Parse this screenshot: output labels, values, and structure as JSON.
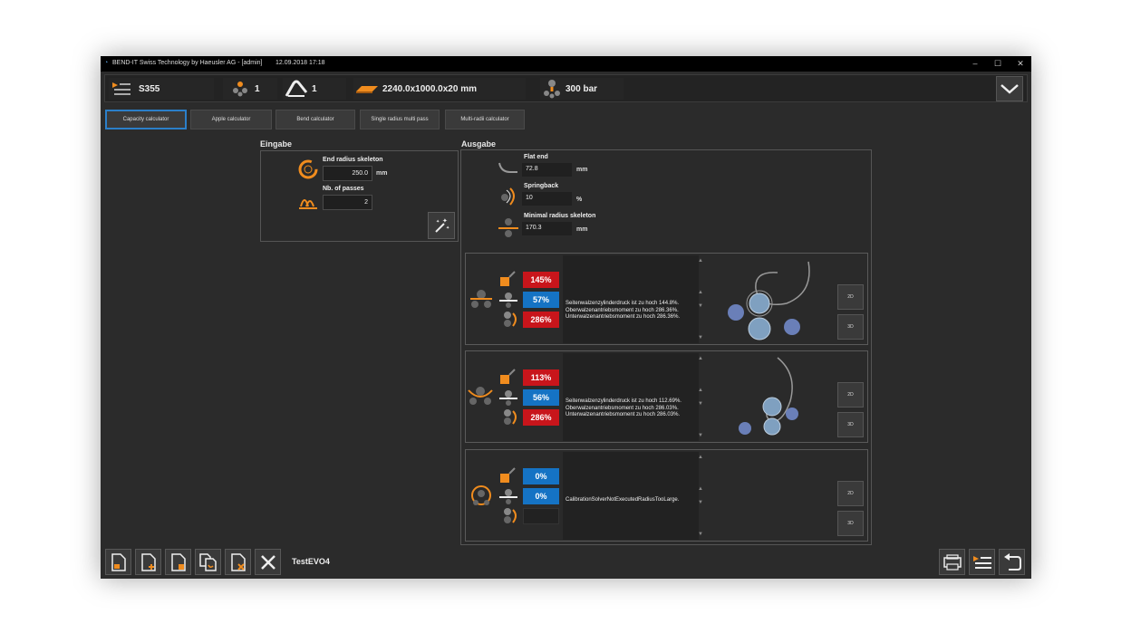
{
  "window": {
    "title": "BEND-IT Swiss Technology by Haeusler AG - [admin]",
    "datetime": "12.09.2018 17:18",
    "controls": [
      "–",
      "☐",
      "✕"
    ]
  },
  "topbar": {
    "material": "S355",
    "rolls_count": "1",
    "passes": "1",
    "plate_dims": "2240.0x1000.0x20 mm",
    "pressure": "300 bar"
  },
  "tabs": [
    {
      "label": "Capacity calculator",
      "active": true
    },
    {
      "label": "Apple calculator",
      "active": false
    },
    {
      "label": "Bend calculator",
      "active": false
    },
    {
      "label": "Single radius multi pass",
      "active": false
    },
    {
      "label": "Multi-radii calculator",
      "active": false
    }
  ],
  "input": {
    "title": "Eingabe",
    "end_radius_label": "End radius skeleton",
    "end_radius_value": "250.0",
    "end_radius_unit": "mm",
    "passes_label": "Nb. of passes",
    "passes_value": "2"
  },
  "output": {
    "title": "Ausgabe",
    "flat_end_label": "Flat end",
    "flat_end_value": "72.8",
    "flat_end_unit": "mm",
    "springback_label": "Springback",
    "springback_value": "10",
    "springback_unit": "%",
    "min_radius_label": "Minimal radius skeleton",
    "min_radius_value": "170.3",
    "min_radius_unit": "mm"
  },
  "results": [
    {
      "badges": [
        {
          "text": "145%",
          "color": "red"
        },
        {
          "text": "57%",
          "color": "blue"
        },
        {
          "text": "286%",
          "color": "red"
        }
      ],
      "message": "Seitenwalzenzylinderdruck ist zu hoch 144.8%.\nOberwalzenantriebsmoment zu hoch 286.36%.\nUnterwalzenantriebsmoment zu hoch 286.36%.",
      "btn_2d": "2D",
      "btn_3d": "3D"
    },
    {
      "badges": [
        {
          "text": "113%",
          "color": "red"
        },
        {
          "text": "56%",
          "color": "blue"
        },
        {
          "text": "286%",
          "color": "red"
        }
      ],
      "message": "Seitenwalzenzylinderdruck ist zu hoch 112.69%.\nOberwalzenantriebsmoment zu hoch 286.03%.\nUnterwalzenantriebsmoment zu hoch 286.03%.",
      "btn_2d": "2D",
      "btn_3d": "3D"
    },
    {
      "badges": [
        {
          "text": "0%",
          "color": "blue"
        },
        {
          "text": "0%",
          "color": "blue"
        },
        {
          "text": "",
          "color": "empty"
        }
      ],
      "message": "CalibrationSolverNotExecutedRadiusTooLarge.",
      "btn_2d": "2D",
      "btn_3d": "3D"
    }
  ],
  "footer": {
    "document_name": "TestEVO4"
  },
  "colors": {
    "accent_orange": "#f08c1e",
    "badge_red": "#c8151b",
    "badge_blue": "#1573c4",
    "tab_active_border": "#2b7fc9"
  }
}
